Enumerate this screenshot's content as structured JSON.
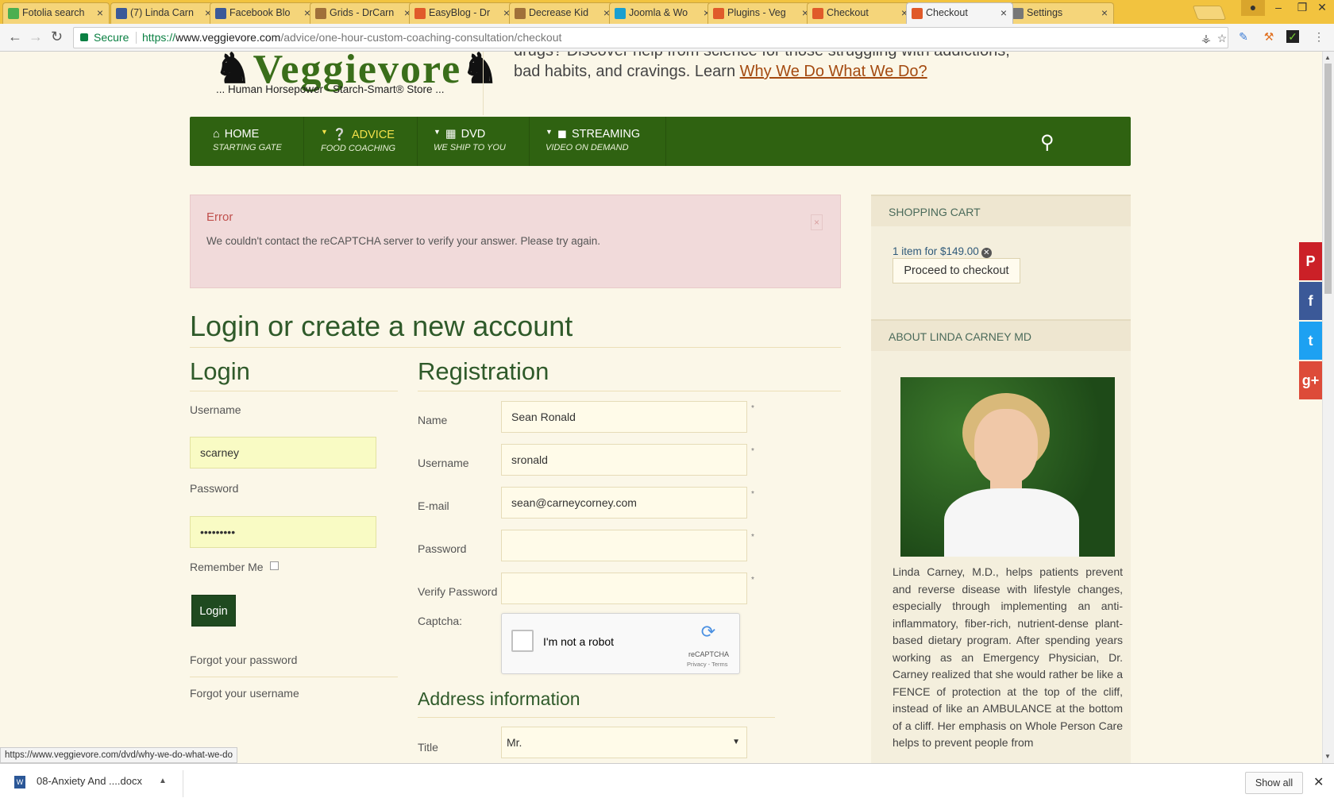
{
  "browser": {
    "tabs": [
      {
        "title": "Fotolia search",
        "icon": "fotolia-icon",
        "color": "#4caf50"
      },
      {
        "title": "(7) Linda Carn",
        "icon": "facebook-icon",
        "color": "#3b5998"
      },
      {
        "title": "Facebook Blo",
        "icon": "facebook-icon",
        "color": "#3b5998"
      },
      {
        "title": "Grids - DrCarn",
        "icon": "avatar-icon",
        "color": "#a0703a"
      },
      {
        "title": "EasyBlog - Dr",
        "icon": "veggievore-icon",
        "color": "#e05a2a"
      },
      {
        "title": "Decrease Kid",
        "icon": "avatar-icon",
        "color": "#a0703a"
      },
      {
        "title": "Joomla & Wo",
        "icon": "joomla-icon",
        "color": "#1a9fd0"
      },
      {
        "title": "Plugins - Veg",
        "icon": "veggievore-icon",
        "color": "#e05a2a"
      },
      {
        "title": "Checkout",
        "icon": "veggievore-icon",
        "color": "#e05a2a"
      },
      {
        "title": "Checkout",
        "icon": "veggievore-icon",
        "color": "#e05a2a"
      },
      {
        "title": "Settings",
        "icon": "gear-icon",
        "color": "#777777"
      }
    ],
    "active_tab": 9,
    "secure_label": "Secure",
    "url_scheme": "https://",
    "url_domain": "www.veggievore.com",
    "url_path": "/advice/one-hour-custom-coaching-consultation/checkout"
  },
  "header": {
    "logo_text": "Veggievore",
    "store_tagline": "... Human Horsepower - Starch-Smart® Store ...",
    "intro_line1": "drugs? Discover help from science for those struggling with addictions,",
    "intro_line2": "bad habits, and cravings. Learn ",
    "intro_link": "Why We Do What We Do?"
  },
  "nav": {
    "items": [
      {
        "label": "HOME",
        "sub": "STARTING GATE",
        "icon": "home-icon"
      },
      {
        "label": "ADVICE",
        "sub": "FOOD COACHING",
        "icon": "question-icon"
      },
      {
        "label": "DVD",
        "sub": "WE SHIP TO YOU",
        "icon": "film-icon"
      },
      {
        "label": "STREAMING",
        "sub": "VIDEO ON DEMAND",
        "icon": "video-camera-icon"
      }
    ]
  },
  "error": {
    "title": "Error",
    "message": "We couldn't contact the reCAPTCHA server to verify your answer. Please try again.",
    "close": "×"
  },
  "main": {
    "title": "Login or create a new account",
    "login": {
      "heading": "Login",
      "username_label": "Username",
      "username_value": "scarney",
      "password_label": "Password",
      "password_value": "•••••••••",
      "remember_label": "Remember Me",
      "submit_label": "Login",
      "forgot_password": "Forgot your password",
      "forgot_username": "Forgot your username"
    },
    "registration": {
      "heading": "Registration",
      "name_label": "Name",
      "name_value": "Sean Ronald",
      "username_label": "Username",
      "username_value": "sronald",
      "email_label": "E-mail",
      "email_value": "sean@carneycorney.com",
      "password_label": "Password",
      "verify_label": "Verify Password",
      "captcha_label": "Captcha:",
      "captcha_text": "I'm not a robot",
      "captcha_brand": "reCAPTCHA",
      "captcha_terms": "Privacy - Terms",
      "required_mark": "*"
    },
    "address": {
      "heading": "Address information",
      "title_label": "Title",
      "title_value": "Mr."
    }
  },
  "sidebar": {
    "cart_heading": "SHOPPING CART",
    "cart_summary": "1 item for $149.00",
    "checkout_label": "Proceed to checkout",
    "about_heading": "ABOUT LINDA CARNEY MD",
    "about_text": "Linda Carney, M.D., helps patients prevent and reverse disease with lifestyle changes, especially through implementing an anti-inflammatory, fiber-rich, nutrient-dense plant-based dietary program. After spending years working as an Emergency Physician, Dr. Carney realized that she would rather be like a FENCE of protection at the top of the cliff, instead of like an AMBULANCE at the bottom of a cliff. Her emphasis on Whole Person Care helps to prevent people from"
  },
  "social": [
    {
      "name": "pinterest",
      "glyph": "P",
      "color": "#cb2027"
    },
    {
      "name": "facebook",
      "glyph": "f",
      "color": "#3b5998"
    },
    {
      "name": "twitter",
      "glyph": "t",
      "color": "#1da1f2"
    },
    {
      "name": "google-plus",
      "glyph": "g+",
      "color": "#dd4b39"
    }
  ],
  "status_url": "https://www.veggievore.com/dvd/why-we-do-what-we-do",
  "downloads": {
    "file": "08-Anxiety And ....docx",
    "show_all": "Show all"
  }
}
